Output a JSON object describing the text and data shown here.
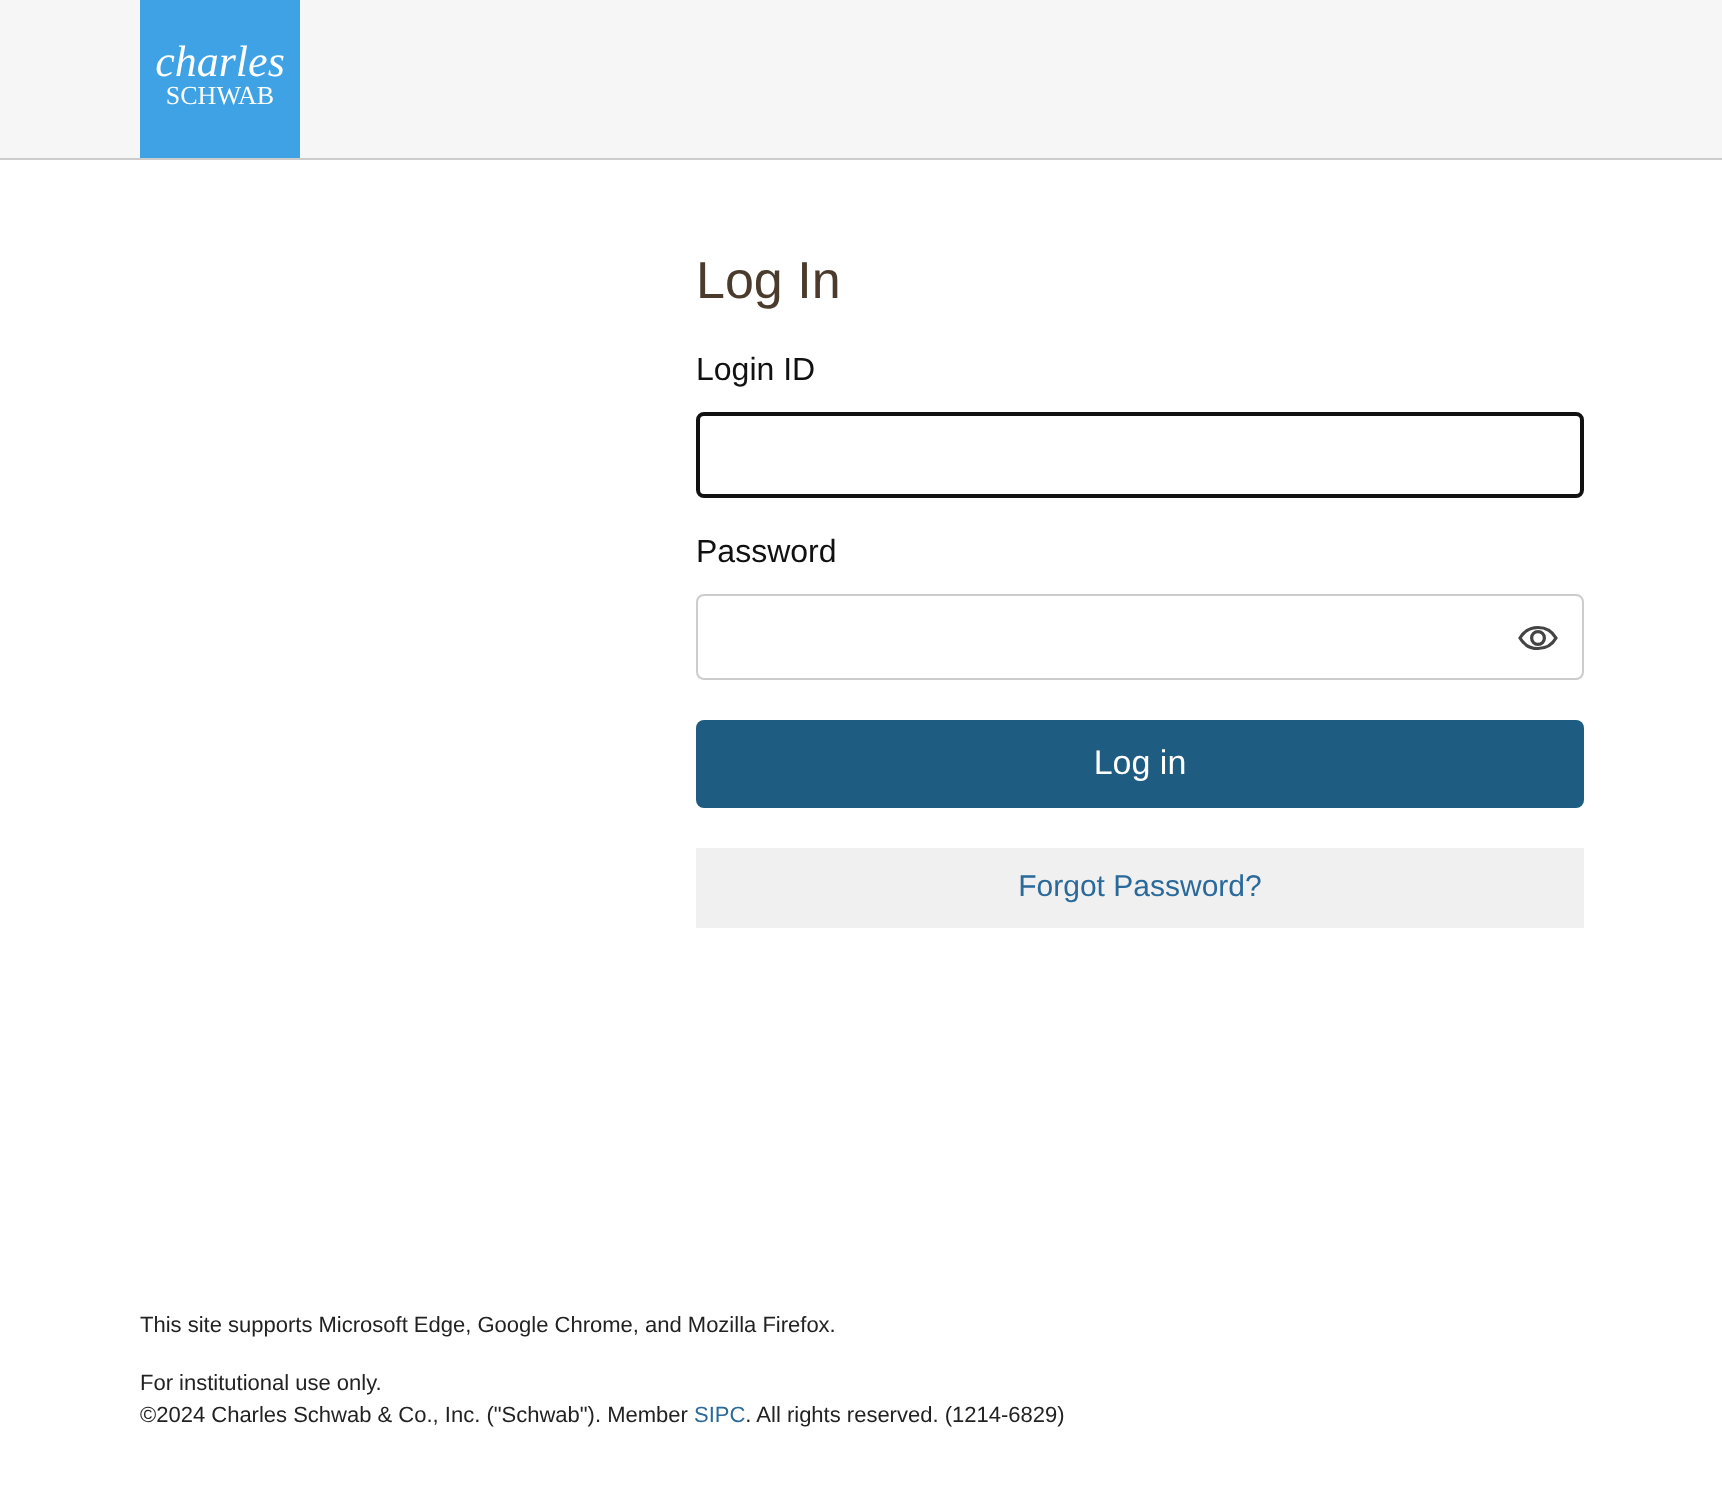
{
  "header": {
    "logo": {
      "line_1": "charles",
      "line_2": "SCHWAB"
    }
  },
  "form": {
    "title": "Log In",
    "fields": [
      {
        "label": "Login ID",
        "focused": true,
        "kind": "text"
      },
      {
        "label": "Password",
        "focused": false,
        "kind": "password"
      }
    ],
    "submit": "Log in",
    "forgot": "Forgot Password?"
  },
  "footer": {
    "support": "This site supports Microsoft Edge, Google Chrome, and Mozilla Firefox.",
    "notice": "For institutional use only.",
    "copyright": {
      "before": "©2024 Charles Schwab & Co., Inc. (\"Schwab\"). Member ",
      "link": "SIPC",
      "after": ". All rights reserved. (1214-6829)"
    }
  }
}
